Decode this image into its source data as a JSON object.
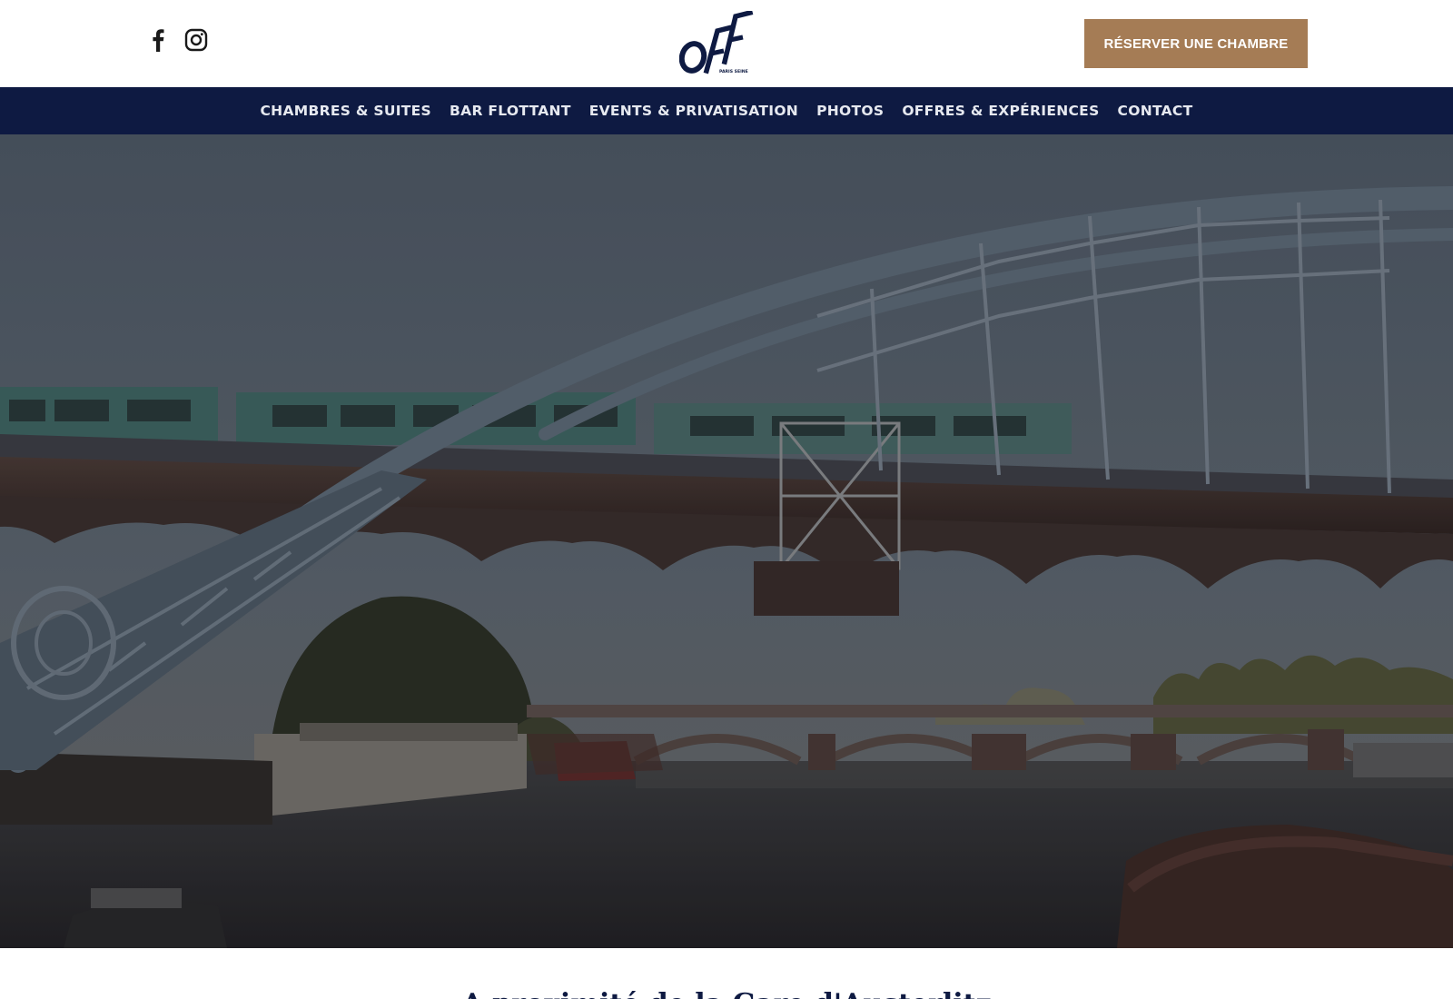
{
  "header": {
    "social_icons": [
      "facebook-icon",
      "instagram-icon"
    ],
    "logo": {
      "text": "OFF",
      "subtext": "PARIS SEINE"
    },
    "reserve_button": "RÉSERVER UNE CHAMBRE"
  },
  "nav": {
    "items": [
      {
        "label": "CHAMBRES & SUITES"
      },
      {
        "label": "BAR FLOTTANT"
      },
      {
        "label": "EVENTS & PRIVATISATION"
      },
      {
        "label": "PHOTOS"
      },
      {
        "label": "OFFRES & EXPÉRIENCES"
      },
      {
        "label": "CONTACT"
      }
    ]
  },
  "hero": {
    "image_subject": "paris-bridge-metro-seine"
  },
  "intro": {
    "heading": "A proximité de la Gare d'Austerlitz"
  },
  "colors": {
    "navy": "#0e1a42",
    "accent_tan": "#a57c55",
    "nav_text": "#e6e9f0"
  }
}
